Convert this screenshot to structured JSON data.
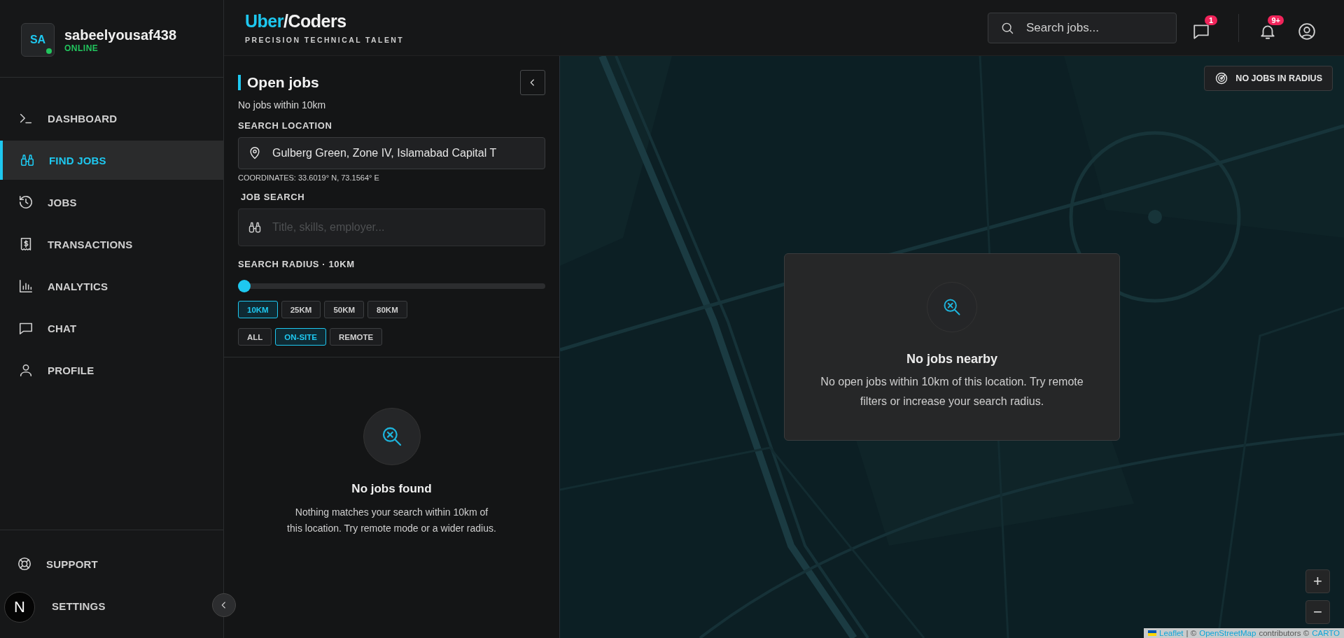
{
  "user": {
    "initials": "SA",
    "name": "sabeelyousaf438",
    "status": "ONLINE",
    "online": true
  },
  "nav": {
    "items": [
      {
        "label": "DASHBOARD",
        "selected": false
      },
      {
        "label": "FIND JOBS",
        "selected": true
      },
      {
        "label": "JOBS",
        "selected": false
      },
      {
        "label": "TRANSACTIONS",
        "selected": false
      },
      {
        "label": "ANALYTICS",
        "selected": false
      },
      {
        "label": "CHAT",
        "selected": false
      },
      {
        "label": "PROFILE",
        "selected": false
      }
    ]
  },
  "footer_nav": {
    "items": [
      {
        "label": "SUPPORT"
      },
      {
        "label": "SETTINGS"
      }
    ]
  },
  "dev_badge": {
    "label": "N"
  },
  "header": {
    "logo": {
      "accent": "Uber",
      "text": "/Coders"
    },
    "tagline": "PRECISION TECHNICAL TALENT",
    "search": {
      "placeholder": "Search jobs..."
    },
    "messages_badge": "1",
    "notifications_badge": "9+"
  },
  "panel": {
    "title": "Open jobs",
    "subtitle": "No jobs within 10km",
    "location_label": "SEARCH LOCATION",
    "location_value": "Gulberg Green, Zone IV, Islamabad Capital T",
    "coordinates": "COORDINATES: 33.6019° N, 73.1564° E",
    "job_search_label": "JOB SEARCH",
    "job_search": {
      "placeholder": "Title, skills, employer..."
    },
    "radius_label": "SEARCH RADIUS · 10KM",
    "radius_slider": {
      "level": 0
    },
    "radius_chips": [
      {
        "label": "10KM",
        "selected": true
      },
      {
        "label": "25KM",
        "selected": false
      },
      {
        "label": "50KM",
        "selected": false
      },
      {
        "label": "80KM",
        "selected": false
      }
    ],
    "mode_chips": [
      {
        "label": "ALL",
        "selected": false
      },
      {
        "label": "ON-SITE",
        "selected": true
      },
      {
        "label": "REMOTE",
        "selected": false
      }
    ]
  },
  "results": {
    "title": "No jobs found",
    "message": "Nothing matches your search within 10km of this location. Try remote mode or a wider radius."
  },
  "map": {
    "kind": "picture",
    "status_chip": "NO JOBS IN RADIUS",
    "empty_card": {
      "title": "No jobs nearby",
      "message": "No open jobs within 10km of this location. Try remote filters or increase your search radius."
    },
    "zoom_in": "+",
    "zoom_out": "−",
    "attribution": {
      "link_1": "Leaflet",
      "separator": "| ©",
      "link_2": "OpenStreetMap",
      "contributors": "contributors ©",
      "link_3": "CARTO"
    }
  }
}
